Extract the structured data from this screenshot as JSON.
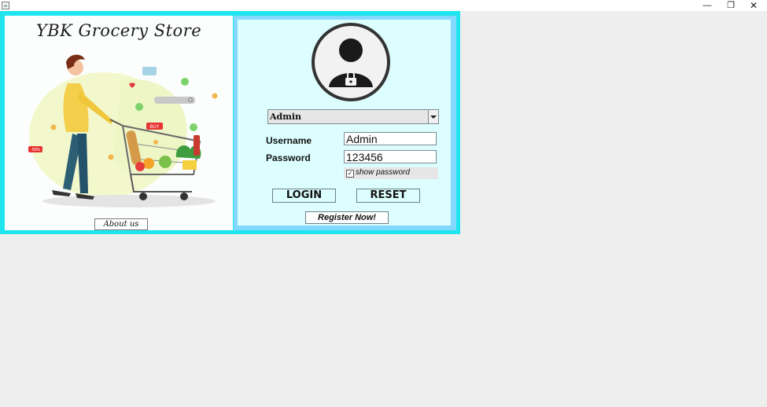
{
  "window": {
    "controls": {
      "minimize": "—",
      "maximize": "❐",
      "close": "✕"
    }
  },
  "store": {
    "title": "YBK Grocery Store",
    "about_label": "About us"
  },
  "illustration": {
    "badge_buy": "BUY",
    "badge_discount": "-50%"
  },
  "login": {
    "role": {
      "selected": "Admin"
    },
    "username": {
      "label": "Username",
      "value": "Admin"
    },
    "password": {
      "label": "Password",
      "value": "123456"
    },
    "show_password": {
      "label": "show password",
      "checked": true
    },
    "login_label": "LOGIN",
    "reset_label": "RESET",
    "register_label": "Register Now!"
  },
  "colors": {
    "frame": "#1fe6ee",
    "login_border": "#82d8ff",
    "login_bg": "#dcfefe"
  }
}
